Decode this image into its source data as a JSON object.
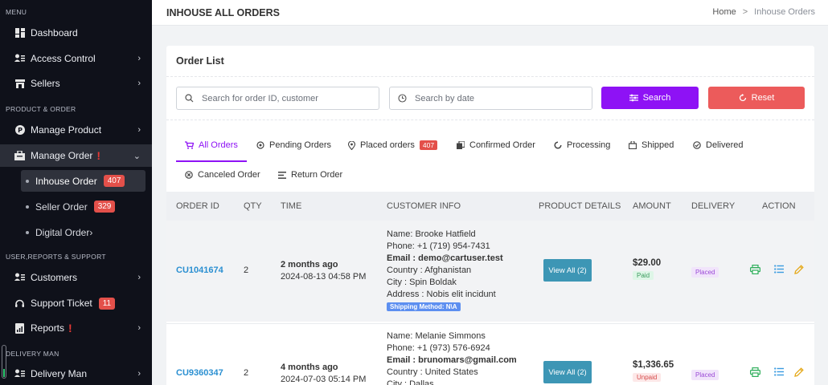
{
  "sidebar": {
    "sections": {
      "menu": "MENU",
      "product_order": "PRODUCT & ORDER",
      "user_reports": "USER,REPORTS & SUPPORT",
      "delivery_man": "DELIVERY MAN"
    },
    "items": {
      "dashboard": "Dashboard",
      "access_control": "Access Control",
      "sellers": "Sellers",
      "manage_product": "Manage Product",
      "manage_order": "Manage Order",
      "inhouse_order": "Inhouse Order",
      "inhouse_order_count": "407",
      "seller_order": "Seller Order",
      "seller_order_count": "329",
      "digital_order": "Digital Order",
      "customers": "Customers",
      "support_ticket": "Support Ticket",
      "support_ticket_count": "11",
      "reports": "Reports",
      "delivery_man": "Delivery Man"
    },
    "alert_mark": "!"
  },
  "topbar": {
    "title": "INHOUSE ALL ORDERS",
    "breadcrumb_home": "Home",
    "breadcrumb_sep": ">",
    "breadcrumb_current": "Inhouse Orders"
  },
  "card": {
    "title": "Order List",
    "search_placeholder": "Search for order ID, customer",
    "date_placeholder": "Search by date",
    "search_button": "Search",
    "reset_button": "Reset"
  },
  "tabs": {
    "all": "All Orders",
    "pending": "Pending Orders",
    "placed": "Placed orders",
    "placed_count": "407",
    "confirmed": "Confirmed Order",
    "processing": "Processing",
    "shipped": "Shipped",
    "delivered": "Delivered",
    "canceled": "Canceled Order",
    "returned": "Return Order"
  },
  "table": {
    "headers": {
      "order_id": "ORDER ID",
      "qty": "QTY",
      "time": "TIME",
      "customer": "CUSTOMER INFO",
      "product": "PRODUCT DETAILS",
      "amount": "AMOUNT",
      "delivery": "DELIVERY",
      "action": "ACTION"
    },
    "rows": [
      {
        "order_id": "CU1041674",
        "qty": "2",
        "time_relative": "2 months ago",
        "time_exact": "2024-08-13 04:58 PM",
        "name": "Name: Brooke Hatfield",
        "phone": "Phone: +1 (719) 954-7431",
        "email": "Email : demo@cartuser.test",
        "country": "Country : Afghanistan",
        "city": "City : Spin Boldak",
        "address": "Address : Nobis elit incidunt",
        "shipping": "Shipping Method: N\\A",
        "view_label": "View All (2)",
        "amount": "$29.00",
        "payment": "Paid",
        "delivery": "Placed"
      },
      {
        "order_id": "CU9360347",
        "qty": "2",
        "time_relative": "4 months ago",
        "time_exact": "2024-07-03 05:14 PM",
        "name": "Name: Melanie Simmons",
        "phone": "Phone: +1 (973) 576-6924",
        "email": "Email : brunomars@gmail.com",
        "country": "Country : United States",
        "city": "City : Dallas",
        "view_label": "View All (2)",
        "amount": "$1,336.65",
        "payment": "Unpaid",
        "delivery": "Placed"
      }
    ]
  },
  "colors": {
    "accent": "#8e12f5",
    "reset": "#ec5b5b",
    "link": "#2a8fd1",
    "sidebar_bg": "#0f111a"
  }
}
